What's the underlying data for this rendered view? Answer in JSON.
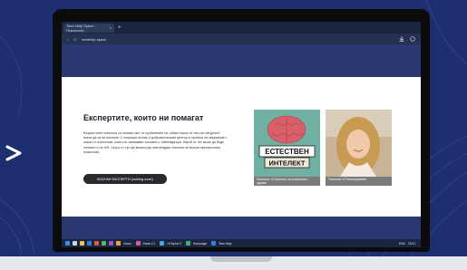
{
  "browser": {
    "tab_title": "Teen Help Space - Психологи",
    "tab_close": "×",
    "new_tab": "+",
    "url": "teenhelp.space",
    "back": "‹",
    "reload": "C"
  },
  "page": {
    "heading": "Експертите, които ни помагат",
    "description": "Възрастните понякога са голяма част от проблемите ни, обаче някои от тях със сигурност могат да са ни полезни. С помощта на вас и доброволческия център в проекта ни свързахме с някои от психолози, които се занимават основно с тийнейджъри. Някой от тях може да бъде полезен и на теб. Скоро от тук ще можеш да преглеждаш списъка на всички препоръчани психолози.",
    "button": "ВСИЧКИ ЕКСПЕРТИ (coming soon)"
  },
  "cards": [
    {
      "image_text_line1": "ЕСТЕСТВЕН",
      "image_text_line2": "ИНТЕЛЕКТ",
      "caption": "Психолог и Психолог за психичното здраве"
    },
    {
      "caption": "Психолог и Психотерапевт"
    }
  ],
  "taskbar": {
    "labels": [
      "Camo",
      "Room 2.1",
      "OI Бутон 9",
      "Нов разде",
      "Teen Help"
    ],
    "language": "ENG",
    "time": "15:21"
  },
  "colors": {
    "background": "#1d2f6e",
    "site_header": "#2b3770",
    "button": "#2a2a2e",
    "brain": "#d9606a",
    "card_bg": "#6fb0a2"
  }
}
